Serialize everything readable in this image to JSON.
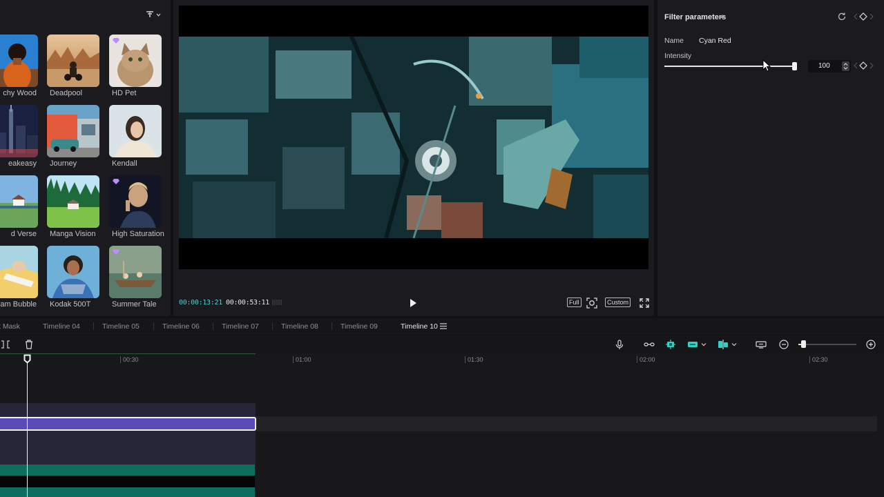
{
  "library": {
    "filter_icon": "sort-filter-icon",
    "tiles": [
      {
        "label": "chy Wood",
        "premium": false
      },
      {
        "label": "Deadpool",
        "premium": false
      },
      {
        "label": "HD Pet",
        "premium": true
      },
      {
        "label": "eakeasy",
        "premium": false
      },
      {
        "label": "Journey",
        "premium": false
      },
      {
        "label": "Kendall",
        "premium": false
      },
      {
        "label": "d Verse",
        "premium": false
      },
      {
        "label": "Manga Vision",
        "premium": false
      },
      {
        "label": "High Saturation",
        "premium": true
      },
      {
        "label": "am Bubble",
        "premium": false
      },
      {
        "label": "Kodak 500T",
        "premium": false
      },
      {
        "label": "Summer Tale",
        "premium": true
      }
    ]
  },
  "preview": {
    "current_time": "00:00:13:21",
    "total_time": "00:00:53:11",
    "btn_full": "Full",
    "btn_custom": "Custom"
  },
  "params": {
    "title": "Filter parameters",
    "name_label": "Name",
    "name_value": "Cyan Red",
    "intensity_label": "Intensity",
    "intensity_value": "100",
    "intensity_fraction": 1.0
  },
  "tabs": [
    {
      "label": "t Mask",
      "active": false
    },
    {
      "label": "Timeline 04",
      "active": false
    },
    {
      "label": "Timeline 05",
      "active": false
    },
    {
      "label": "Timeline 06",
      "active": false
    },
    {
      "label": "Timeline 07",
      "active": false
    },
    {
      "label": "Timeline 08",
      "active": false
    },
    {
      "label": "Timeline 09",
      "active": false
    },
    {
      "label": "Timeline 10",
      "active": true
    }
  ],
  "ruler": [
    "00:30",
    "01:00",
    "01:30",
    "02:00",
    "02:30"
  ],
  "colors": {
    "accent_teal": "#3fd6cf",
    "clip_purple": "#5a4bb8",
    "clip_teal": "#0e6e5e",
    "panel_bg": "#1b1b1f"
  }
}
